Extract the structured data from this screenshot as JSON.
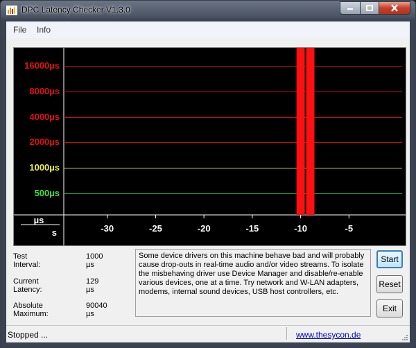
{
  "window": {
    "title": "DPC Latency Checker V1.3.0"
  },
  "menu": {
    "items": [
      "File",
      "Info"
    ]
  },
  "chart_data": {
    "type": "bar",
    "y_axis_labels": [
      {
        "text": "16000µs",
        "color": "#e01010"
      },
      {
        "text": "8000µs",
        "color": "#e01010"
      },
      {
        "text": "4000µs",
        "color": "#e01010"
      },
      {
        "text": "2000µs",
        "color": "#e01010"
      },
      {
        "text": "1000µs",
        "color": "#f0f040"
      },
      {
        "text": "500µs",
        "color": "#40e040"
      }
    ],
    "thresholds": [
      {
        "value": 16000,
        "color": "#c01010"
      },
      {
        "value": 8000,
        "color": "#c01010"
      },
      {
        "value": 4000,
        "color": "#c01010"
      },
      {
        "value": 2000,
        "color": "#c01010"
      },
      {
        "value": 1000,
        "color": "#d8d840"
      },
      {
        "value": 500,
        "color": "#30c030"
      }
    ],
    "axis_units": {
      "y": "µs",
      "x": "s"
    },
    "x_ticks": [
      "-30",
      "-25",
      "-20",
      "-15",
      "-10",
      "-5"
    ],
    "x_range": [
      -34,
      0
    ],
    "bars": [
      {
        "t": -33,
        "v": 130,
        "c": "#30e030"
      },
      {
        "t": -32,
        "v": 150,
        "c": "#30e030"
      },
      {
        "t": -31,
        "v": 115,
        "c": "#30e030"
      },
      {
        "t": -30,
        "v": 118,
        "c": "#30e030"
      },
      {
        "t": -29,
        "v": 120,
        "c": "#30e030"
      },
      {
        "t": -28,
        "v": 140,
        "c": "#30e030"
      },
      {
        "t": -27,
        "v": 132,
        "c": "#30e030"
      },
      {
        "t": -26,
        "v": 128,
        "c": "#30e030"
      },
      {
        "t": -25,
        "v": 140,
        "c": "#30e030"
      },
      {
        "t": -24,
        "v": 125,
        "c": "#30e030"
      },
      {
        "t": -23,
        "v": 120,
        "c": "#30e030"
      },
      {
        "t": -22,
        "v": 148,
        "c": "#30e030"
      },
      {
        "t": -21,
        "v": 118,
        "c": "#30e030"
      },
      {
        "t": -20,
        "v": 150,
        "c": "#30e030"
      },
      {
        "t": -19,
        "v": 120,
        "c": "#30e030"
      },
      {
        "t": -18,
        "v": 124,
        "c": "#30e030"
      },
      {
        "t": -17,
        "v": 138,
        "c": "#30e030"
      },
      {
        "t": -16,
        "v": 140,
        "c": "#30e030"
      },
      {
        "t": -15,
        "v": 120,
        "c": "#30e030"
      },
      {
        "t": -14,
        "v": 155,
        "c": "#30e030"
      },
      {
        "t": -13,
        "v": 130,
        "c": "#30e030"
      },
      {
        "t": -12,
        "v": 126,
        "c": "#30e030"
      },
      {
        "t": -11,
        "v": 140,
        "c": "#30e030"
      },
      {
        "t": -10,
        "v": 90040,
        "c": "#ff1010"
      },
      {
        "t": -9,
        "v": 90040,
        "c": "#ff1010"
      },
      {
        "t": -8,
        "v": 160,
        "c": "#30e030"
      },
      {
        "t": -7,
        "v": 125,
        "c": "#30e030"
      },
      {
        "t": -6,
        "v": 120,
        "c": "#30e030"
      },
      {
        "t": -5,
        "v": 132,
        "c": "#30e030"
      },
      {
        "t": -4,
        "v": 118,
        "c": "#30e030"
      },
      {
        "t": -3,
        "v": 135,
        "c": "#30e030"
      },
      {
        "t": -2,
        "v": 120,
        "c": "#30e030"
      },
      {
        "t": -1,
        "v": 124,
        "c": "#30e030"
      },
      {
        "t": 0,
        "v": 129,
        "c": "#30e030"
      }
    ]
  },
  "stats": {
    "test_interval_label": "Test Interval:",
    "test_interval_value": "1000 µs",
    "current_latency_label": "Current Latency:",
    "current_latency_value": "129 µs",
    "absolute_max_label": "Absolute Maximum:",
    "absolute_max_value": "90040 µs"
  },
  "info_text": "Some device drivers on this machine behave bad and will probably cause drop-outs in real-time audio and/or video streams. To isolate the misbehaving driver use Device Manager and disable/re-enable various devices, one at a time. Try network and W-LAN adapters, modems, internal sound devices, USB host controllers, etc.",
  "buttons": {
    "start": "Start",
    "reset": "Reset",
    "exit": "Exit"
  },
  "status": {
    "text": "Stopped ...",
    "link": "www.thesycon.de"
  }
}
